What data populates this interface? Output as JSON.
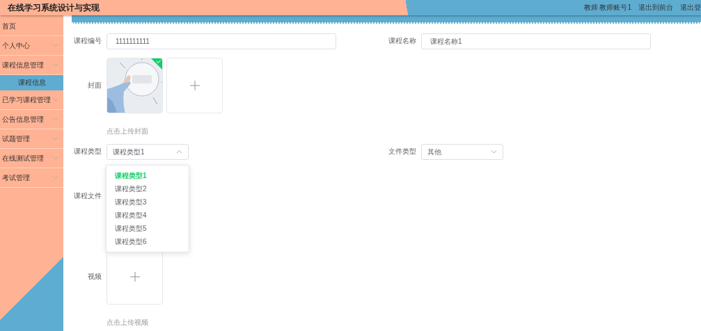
{
  "header": {
    "title": "在线学习系统设计与实现",
    "links": [
      "教师 教师账号1",
      "退出到前台",
      "退出登"
    ]
  },
  "sidebar": {
    "items": [
      {
        "label": "首页",
        "kind": "link"
      },
      {
        "label": "个人中心",
        "kind": "submenu"
      },
      {
        "label": "课程信息管理",
        "kind": "submenu",
        "children": [
          {
            "label": "课程信息",
            "selected": true
          }
        ]
      },
      {
        "label": "已学习课程管理",
        "kind": "submenu"
      },
      {
        "label": "公告信息管理",
        "kind": "submenu"
      },
      {
        "label": "试题管理",
        "kind": "submenu"
      },
      {
        "label": "在线测试管理",
        "kind": "submenu"
      },
      {
        "label": "考试管理",
        "kind": "submenu"
      }
    ]
  },
  "form": {
    "rows": [
      {
        "fields": [
          {
            "kind": "text",
            "label": "课程编号",
            "value": "1111111111"
          },
          {
            "kind": "text",
            "label": "课程名称",
            "value": "课程名称1"
          }
        ]
      },
      {
        "fields": [
          {
            "kind": "upload",
            "label": "封面",
            "files": [
              {
                "kind": "picture",
                "success": true
              }
            ],
            "hint": "点击上传封面"
          }
        ]
      },
      {
        "fields": [
          {
            "kind": "select",
            "label": "课程类型",
            "value": "课程类型1",
            "open": true,
            "options": [
              {
                "label": "课程类型1",
                "selected": true
              },
              {
                "label": "课程类型2",
                "selected": false
              },
              {
                "label": "课程类型3",
                "selected": false
              },
              {
                "label": "课程类型4",
                "selected": false
              },
              {
                "label": "课程类型5",
                "selected": false
              },
              {
                "label": "课程类型6",
                "selected": false
              }
            ]
          },
          {
            "kind": "select",
            "label": "文件类型",
            "value": "其他",
            "open": false
          }
        ]
      },
      {
        "fields": [
          {
            "kind": "file",
            "label": "课程文件"
          }
        ]
      },
      {
        "fields": [
          {
            "kind": "upload",
            "label": "视频",
            "hint": "点击上传视频"
          }
        ]
      }
    ]
  }
}
